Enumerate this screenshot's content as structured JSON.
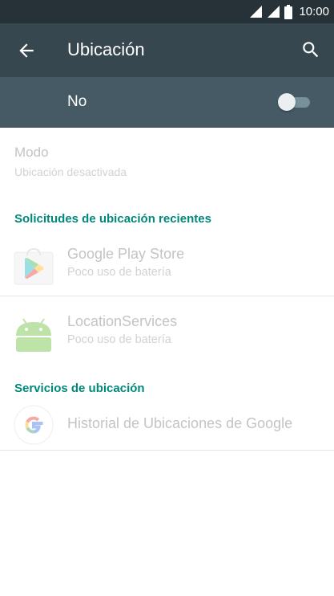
{
  "status_bar": {
    "time": "10:00",
    "icons": [
      "signal-icon",
      "signal-icon",
      "battery-icon"
    ]
  },
  "app_bar": {
    "title": "Ubicación",
    "back_icon": "arrow-back-icon",
    "search_icon": "search-icon"
  },
  "master_switch": {
    "label": "No",
    "state": "off"
  },
  "mode": {
    "title": "Modo",
    "summary": "Ubicación desactivada"
  },
  "recent_requests": {
    "header": "Solicitudes de ubicación recientes",
    "items": [
      {
        "name": "Google Play Store",
        "detail": "Poco uso de batería",
        "icon": "play-store-icon"
      },
      {
        "name": "LocationServices",
        "detail": "Poco uso de batería",
        "icon": "android-icon"
      }
    ]
  },
  "location_services": {
    "header": "Servicios de ubicación",
    "items": [
      {
        "name": "Historial de Ubicaciones de Google",
        "icon": "google-icon"
      }
    ]
  },
  "colors": {
    "status_bar": "#263238",
    "app_bar": "#37474f",
    "switch_bar": "#455a64",
    "accent": "#00897b",
    "disabled_text": "#c4c4c4"
  }
}
